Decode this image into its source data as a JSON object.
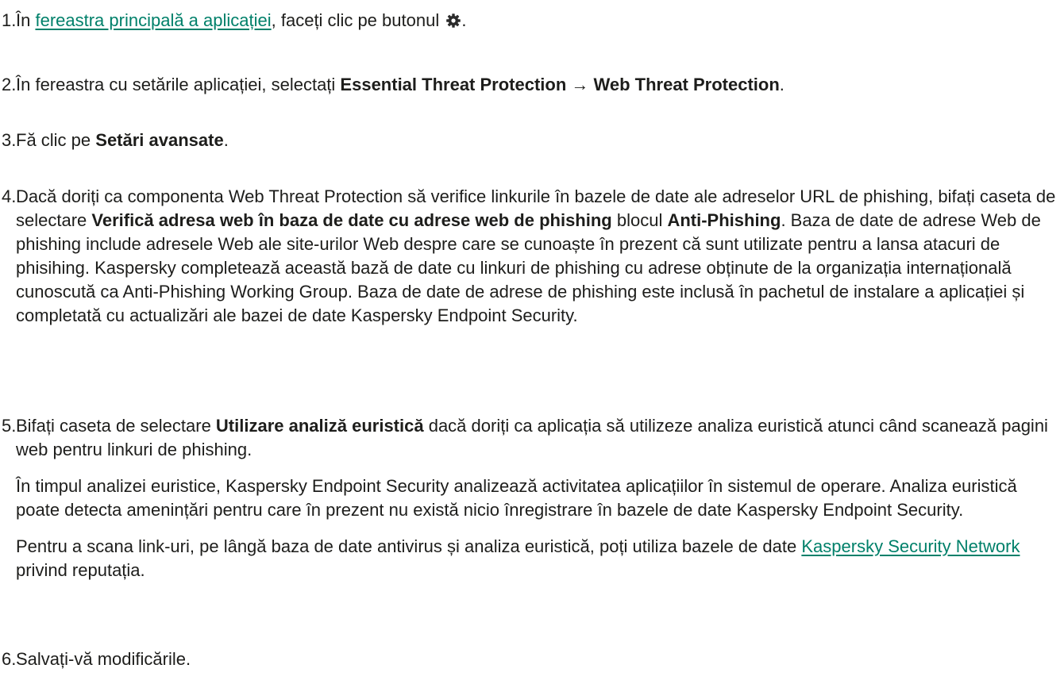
{
  "steps": [
    {
      "number": "1.",
      "parts": {
        "a": "În ",
        "link": "fereastra principală a aplicației",
        "b": ", faceți clic pe butonul ",
        "icon": "gear-icon",
        "c": "."
      }
    },
    {
      "number": "2.",
      "parts": {
        "a": "În fereastra cu setările aplicației, selectați ",
        "bold1": "Essential Threat Protection → Web Threat Protection",
        "b": "."
      }
    },
    {
      "number": "3.",
      "parts": {
        "a": "Fă clic pe ",
        "bold1": "Setări avansate",
        "b": "."
      }
    },
    {
      "number": "4.",
      "parts": {
        "a": "Dacă doriți ca componenta Web Threat Protection să verifice linkurile în bazele de date ale adreselor URL de phishing, bifați caseta de selectare ",
        "bold1": "Verifică adresa web în baza de date cu adrese web de phishing",
        "b": " blocul ",
        "bold2": "Anti-Phishing",
        "c": ". Baza de date de adrese Web de phishing include adresele Web ale site-urilor Web despre care se cunoaște în prezent că sunt utilizate pentru a lansa atacuri de phisihing. Kaspersky completează această bază de date cu linkuri de phishing cu adrese obținute de la organizația internațională cunoscută ca Anti-Phishing Working Group. Baza de date de adrese de phishing este inclusă în pachetul de instalare a aplicației și completată cu actualizări ale bazei de date Kaspersky Endpoint Security."
      }
    },
    {
      "number": "5.",
      "parts": {
        "a": "Bifați caseta de selectare ",
        "bold1": "Utilizare analiză euristică",
        "b": " dacă doriți ca aplicația să utilizeze analiza euristică atunci când scanează pagini web pentru linkuri de phishing."
      },
      "para2": "În timpul analizei euristice, Kaspersky Endpoint Security analizează activitatea aplicațiilor în sistemul de operare. Analiza euristică poate detecta amenințări pentru care în prezent nu există nicio înregistrare în bazele de date Kaspersky Endpoint Security.",
      "para3": {
        "a": "Pentru a scana link-uri, pe lângă baza de date antivirus și analiza euristică, poți utiliza bazele de date ",
        "link": "Kaspersky Security Network",
        "b": " privind reputația."
      }
    },
    {
      "number": "6.",
      "parts": {
        "a": "Salvați-vă modificările."
      }
    }
  ],
  "colors": {
    "text": "#1d1d1b",
    "link": "#00806a",
    "background": "#ffffff"
  }
}
